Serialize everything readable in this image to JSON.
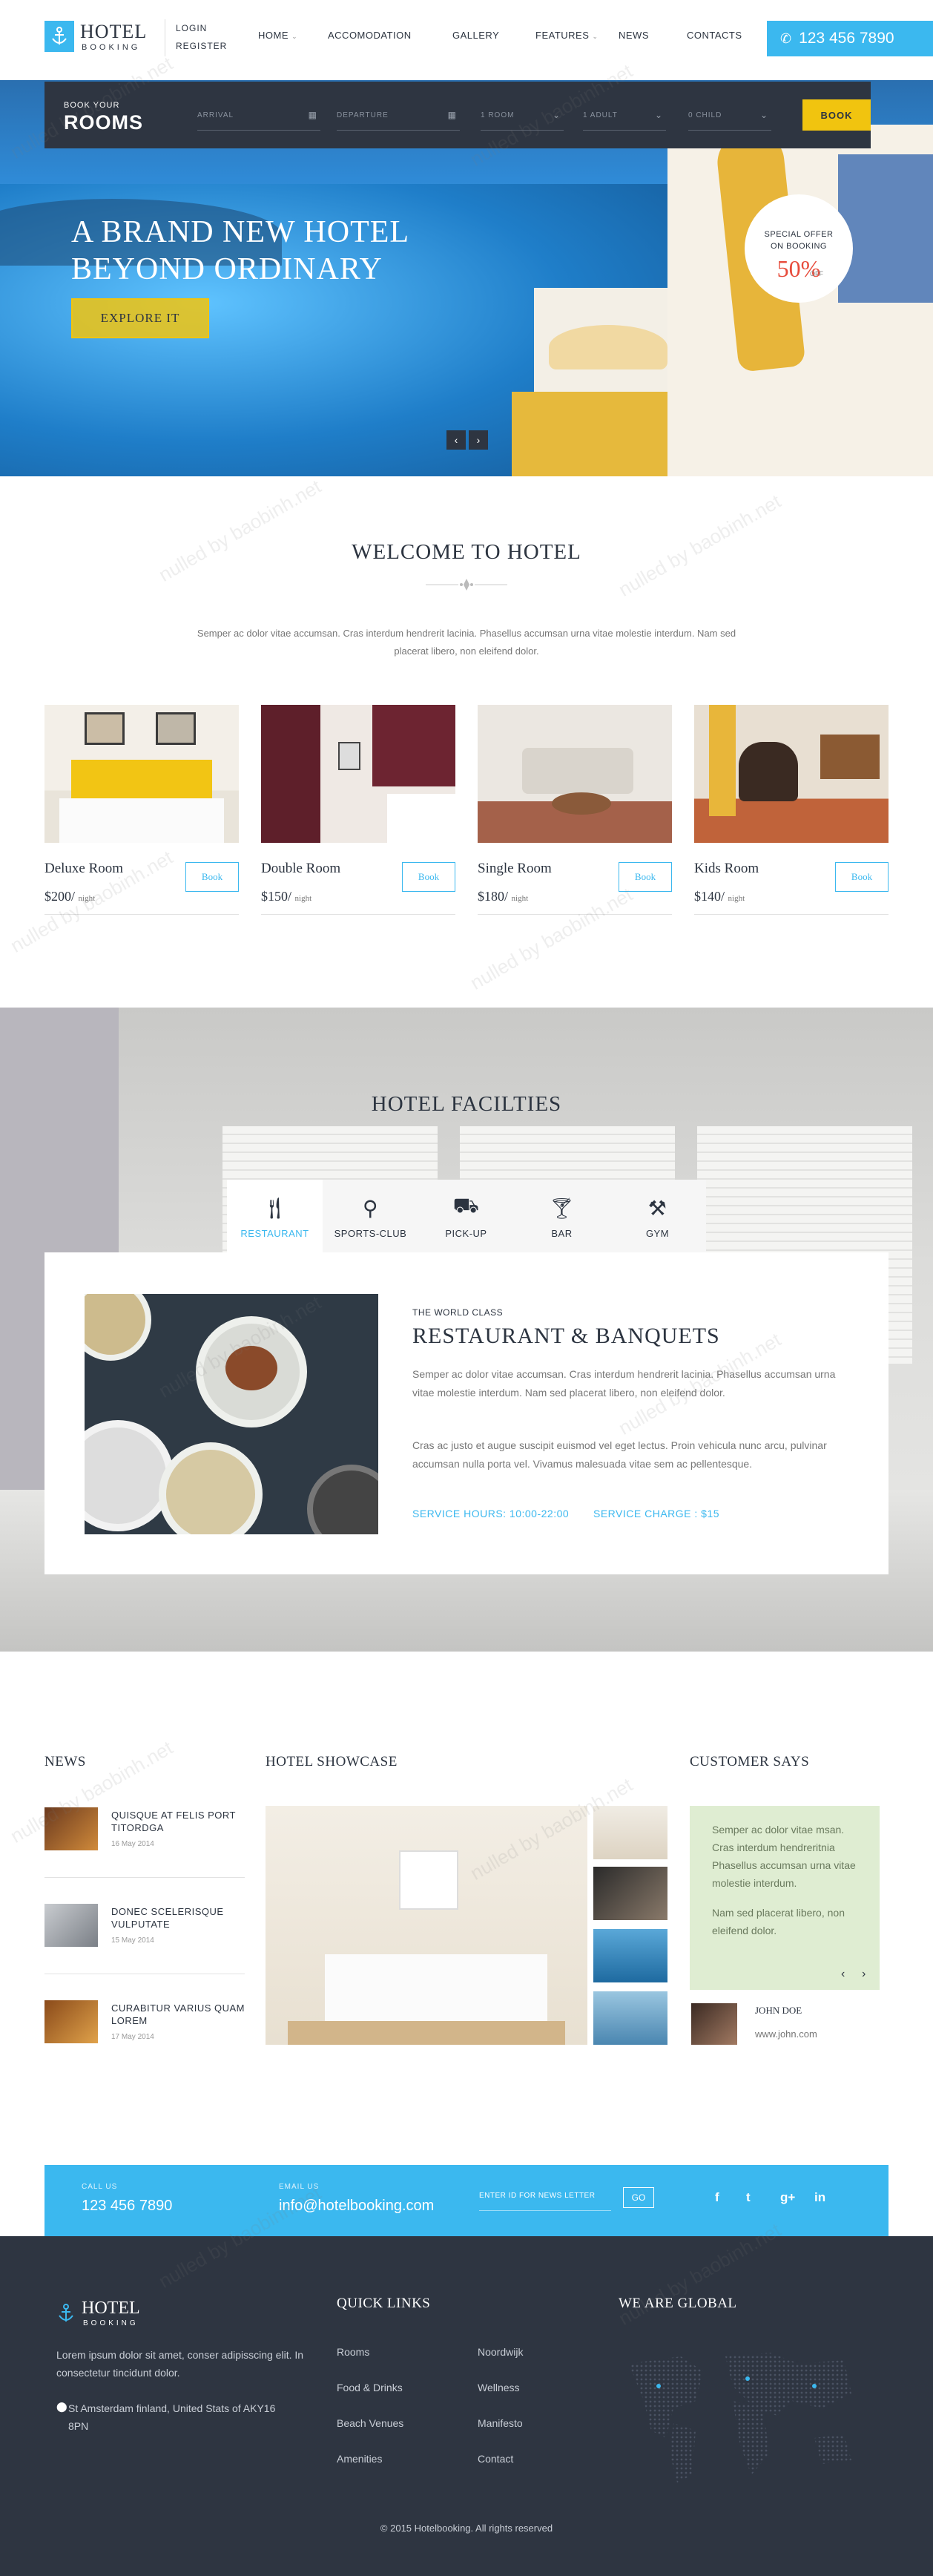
{
  "header": {
    "logo_title": "HOTEL",
    "logo_sub": "BOOKING",
    "login": "LOGIN",
    "register": "REGISTER",
    "nav": [
      "HOME",
      "ACCOMODATION",
      "GALLERY",
      "FEATURES",
      "NEWS",
      "CONTACTS"
    ],
    "phone": "123 456 7890"
  },
  "booking": {
    "label_small": "BOOK YOUR",
    "label_big": "ROOMS",
    "arrival": "ARRIVAL",
    "departure": "DEPARTURE",
    "room": "1 ROOM",
    "adult": "1 ADULT",
    "child": "0 CHILD",
    "button": "BOOK"
  },
  "hero": {
    "title_line1": "A BRAND NEW HOTEL",
    "title_line2": "BEYOND ORDINARY",
    "cta": "EXPLORE IT",
    "offer_line1": "SPECIAL OFFER",
    "offer_line2": "ON BOOKING",
    "offer_value": "50%",
    "offer_suffix": "OFF",
    "prev": "‹",
    "next": "›"
  },
  "welcome": {
    "title": "WELCOME TO HOTEL",
    "text": "Semper ac dolor vitae accumsan. Cras interdum hendrerit lacinia. Phasellus accumsan urna vitae molestie interdum. Nam sed placerat libero, non eleifend dolor."
  },
  "rooms": [
    {
      "name": "Deluxe Room",
      "price": "$200/",
      "unit": "night",
      "button": "Book"
    },
    {
      "name": "Double Room",
      "price": "$150/",
      "unit": "night",
      "button": "Book"
    },
    {
      "name": "Single Room",
      "price": "$180/",
      "unit": "night",
      "button": "Book"
    },
    {
      "name": "Kids Room",
      "price": "$140/",
      "unit": "night",
      "button": "Book"
    }
  ],
  "facilities": {
    "title": "HOTEL FACILTIES",
    "tabs": [
      "RESTAURANT",
      "SPORTS-CLUB",
      "PICK-UP",
      "BAR",
      "GYM"
    ],
    "subtitle": "THE WORLD CLASS",
    "heading": "RESTAURANT & BANQUETS",
    "p1": "Semper ac dolor vitae accumsan. Cras interdum hendrerit lacinia. Phasellus accumsan urna vitae molestie interdum. Nam sed placerat libero, non eleifend dolor.",
    "p2": "Cras ac justo et augue suscipit euismod vel eget lectus. Proin vehicula nunc arcu, pulvinar accumsan nulla porta vel. Vivamus malesuada vitae sem ac pellentesque.",
    "hours": "SERVICE HOURS: 10:00-22:00",
    "charge": "SERVICE CHARGE : $15"
  },
  "news": {
    "title": "NEWS",
    "items": [
      {
        "title": "QUISQUE AT FELIS PORT TITORDGA",
        "date": "16 May 2014"
      },
      {
        "title": "DONEC SCELERISQUE VULPUTATE",
        "date": "15 May 2014"
      },
      {
        "title": "CURABITUR VARIUS QUAM LOREM",
        "date": "17 May 2014"
      }
    ]
  },
  "showcase": {
    "title": "HOTEL SHOWCASE"
  },
  "testimonial": {
    "title": "CUSTOMER SAYS",
    "p1": "Semper ac dolor vitae msan. Cras interdum hendreritnia Phasellus accumsan urna vitae molestie interdum.",
    "p2": "Nam sed placerat libero, non eleifend dolor.",
    "name": "JOHN DOE",
    "site": "www.john.com",
    "prev": "‹",
    "next": "›"
  },
  "newsletter": {
    "call_label": "CALL US",
    "call_value": "123 456 7890",
    "email_label": "EMAIL US",
    "email_value": "info@hotelbooking.com",
    "placeholder": "ENTER ID  FOR NEWS LETTER",
    "go": "GO",
    "social": [
      "f",
      "t",
      "g+",
      "in"
    ]
  },
  "footer": {
    "logo_title": "HOTEL",
    "logo_sub": "BOOKING",
    "about": "Lorem ipsum dolor sit amet, conser adipisscing elit. In consectetur tincidunt dolor.",
    "address": "St Amsterdam finland, United Stats of AKY16 8PN",
    "quick_links_title": "QUICK LINKS",
    "links_col1": [
      "Rooms",
      "Food & Drinks",
      "Beach Venues",
      "Amenities"
    ],
    "links_col2": [
      "Noordwijk",
      "Wellness",
      "Manifesto",
      "Contact"
    ],
    "global_title": "WE ARE GLOBAL",
    "copyright": "© 2015 Hotelbooking. All rights reserved"
  },
  "watermark": "nulled by baobinh.net",
  "colors": {
    "accent": "#3bb8ef",
    "dark": "#2e3541",
    "yellow": "#f1c40f",
    "red": "#e74c3c"
  }
}
